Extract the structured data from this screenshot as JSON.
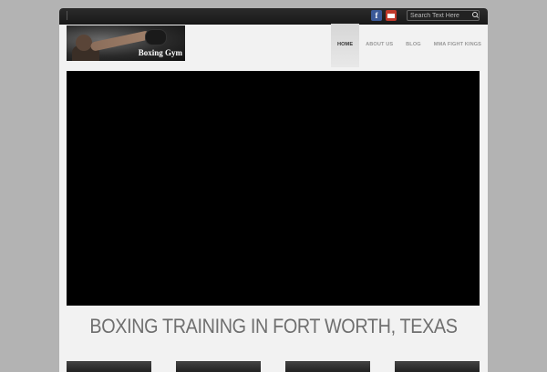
{
  "topbar": {
    "social": [
      {
        "name": "facebook-icon",
        "glyph": "f",
        "color": "#3b5998"
      },
      {
        "name": "rss-icon",
        "color": "#c0392b"
      }
    ],
    "search": {
      "placeholder": "Search Text Here"
    }
  },
  "logo": {
    "text": "Boxing Gym"
  },
  "nav": {
    "items": [
      {
        "label": "HOME",
        "active": true
      },
      {
        "label": "ABOUT US",
        "active": false
      },
      {
        "label": "BLOG",
        "active": false
      },
      {
        "label": "MMA FIGHT KINGS",
        "active": false
      }
    ]
  },
  "main": {
    "headline": "BOXING TRAINING IN FORT WORTH, TEXAS"
  }
}
